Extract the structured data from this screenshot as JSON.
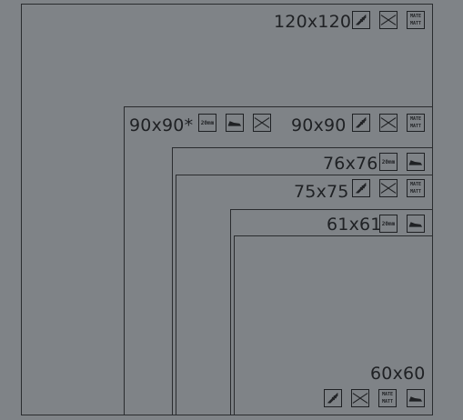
{
  "tiles": [
    {
      "id": "120x120",
      "label": "120x120",
      "icons": [
        "anti-slip-icon",
        "wall-tile-icon",
        "matte-finish-icon"
      ],
      "icon_texts": {
        "matte-finish-icon": [
          "MATE",
          "MATT"
        ]
      }
    },
    {
      "id": "90x90-star",
      "label": "90x90*",
      "icons": [
        "thickness-20mm-icon",
        "floor-shoe-icon",
        "wall-tile-icon"
      ],
      "icon_texts": {
        "thickness-20mm-icon": "20mm"
      }
    },
    {
      "id": "90x90",
      "label": "90x90",
      "icons": [
        "anti-slip-icon",
        "wall-tile-icon",
        "matte-finish-icon"
      ],
      "icon_texts": {
        "matte-finish-icon": [
          "MATE",
          "MATT"
        ]
      }
    },
    {
      "id": "76x76",
      "label": "76x76",
      "icons": [
        "thickness-20mm-icon",
        "floor-shoe-icon"
      ],
      "icon_texts": {
        "thickness-20mm-icon": "20mm"
      }
    },
    {
      "id": "75x75",
      "label": "75x75",
      "icons": [
        "anti-slip-icon",
        "wall-tile-icon",
        "matte-finish-icon"
      ],
      "icon_texts": {
        "matte-finish-icon": [
          "MATE",
          "MATT"
        ]
      }
    },
    {
      "id": "61x61",
      "label": "61x61",
      "icons": [
        "thickness-20mm-icon",
        "floor-shoe-icon"
      ],
      "icon_texts": {
        "thickness-20mm-icon": "20mm"
      }
    },
    {
      "id": "60x60",
      "label": "60x60",
      "icons": [
        "anti-slip-icon",
        "wall-tile-icon",
        "matte-finish-icon",
        "floor-shoe-icon"
      ],
      "icon_texts": {
        "matte-finish-icon": [
          "MATE",
          "MATT"
        ]
      }
    }
  ],
  "colors": {
    "background": "#7f8387",
    "stroke": "#2a2c2f",
    "text": "#1f2124"
  }
}
